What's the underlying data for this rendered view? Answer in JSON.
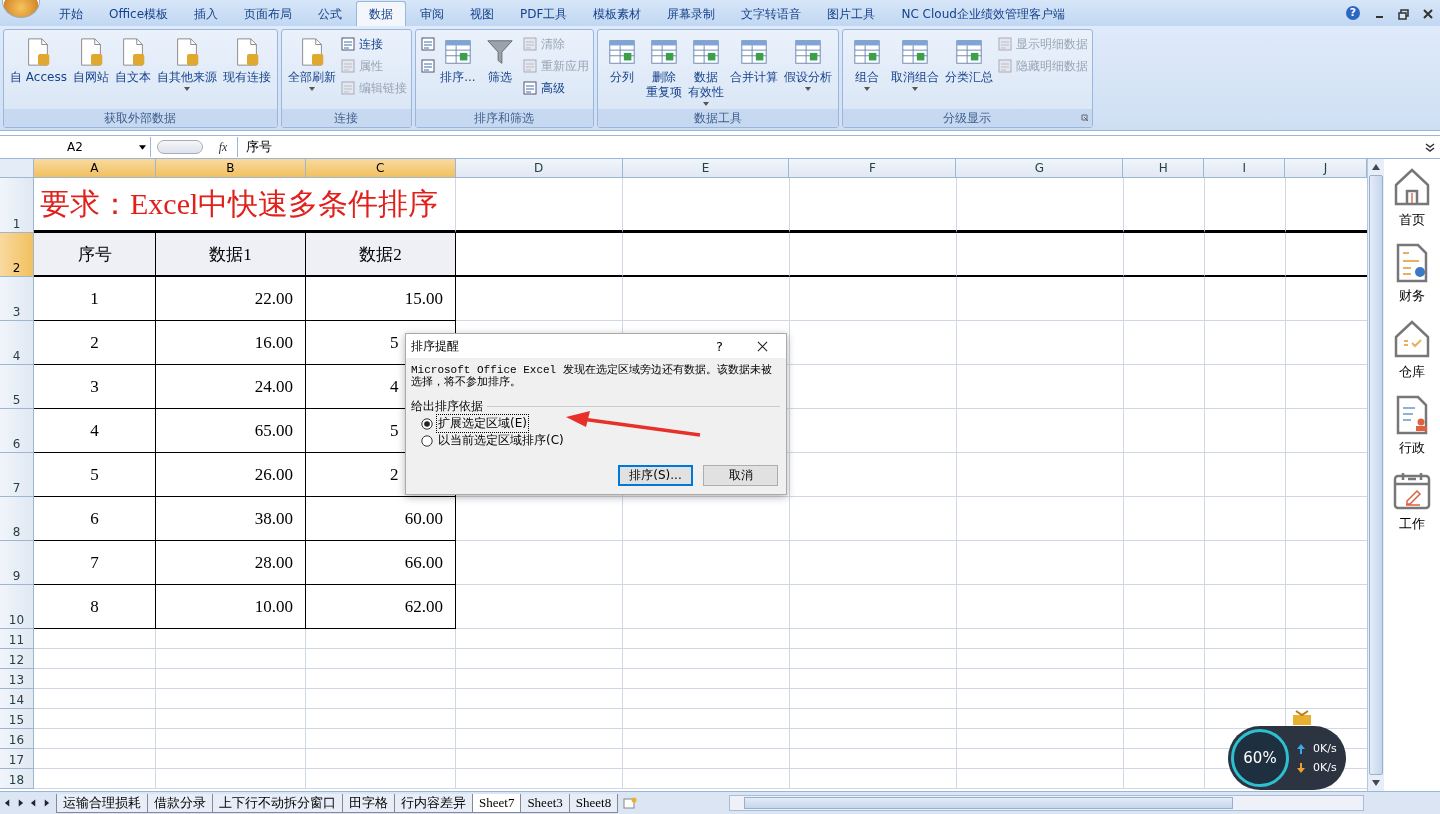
{
  "menu_tabs": [
    {
      "label": "开始",
      "selected": false
    },
    {
      "label": "Office模板",
      "selected": false
    },
    {
      "label": "插入",
      "selected": false
    },
    {
      "label": "页面布局",
      "selected": false
    },
    {
      "label": "公式",
      "selected": false
    },
    {
      "label": "数据",
      "selected": true
    },
    {
      "label": "审阅",
      "selected": false
    },
    {
      "label": "视图",
      "selected": false
    },
    {
      "label": "PDF工具",
      "selected": false
    },
    {
      "label": "模板素材",
      "selected": false
    },
    {
      "label": "屏幕录制",
      "selected": false
    },
    {
      "label": "文字转语音",
      "selected": false
    },
    {
      "label": "图片工具",
      "selected": false
    },
    {
      "label": "NC Cloud企业绩效管理客户端",
      "selected": false
    }
  ],
  "help_glyph": "?",
  "ribbon_groups": [
    {
      "label": "获取外部数据",
      "launcher": false,
      "items": [
        {
          "kind": "large",
          "lines": [
            "自 Access"
          ],
          "dropdown": false
        },
        {
          "kind": "large",
          "lines": [
            "自网站"
          ],
          "dropdown": false
        },
        {
          "kind": "large",
          "lines": [
            "自文本"
          ],
          "dropdown": false
        },
        {
          "kind": "large",
          "lines": [
            "自其他来源"
          ],
          "dropdown": true
        },
        {
          "kind": "large",
          "lines": [
            "现有连接"
          ],
          "dropdown": false
        }
      ]
    },
    {
      "label": "连接",
      "launcher": false,
      "items": [
        {
          "kind": "large",
          "lines": [
            "全部刷新"
          ],
          "dropdown": true
        },
        {
          "kind": "stack",
          "items": [
            {
              "label": "连接",
              "disabled": false
            },
            {
              "label": "属性",
              "disabled": true
            },
            {
              "label": "编辑链接",
              "disabled": true
            }
          ]
        }
      ]
    },
    {
      "label": "排序和筛选",
      "launcher": false,
      "items": [
        {
          "kind": "stack",
          "items": [
            {
              "disabled": false
            },
            {
              "disabled": false
            }
          ]
        },
        {
          "kind": "large",
          "lines": [
            "排序..."
          ],
          "dropdown": false
        },
        {
          "kind": "large",
          "lines": [
            "筛选"
          ],
          "dropdown": false
        },
        {
          "kind": "stack",
          "items": [
            {
              "label": "清除",
              "disabled": true
            },
            {
              "label": "重新应用",
              "disabled": true
            },
            {
              "label": "高级",
              "disabled": false
            }
          ]
        }
      ]
    },
    {
      "label": "数据工具",
      "launcher": false,
      "items": [
        {
          "kind": "large",
          "lines": [
            "分列"
          ],
          "dropdown": false
        },
        {
          "kind": "large",
          "lines": [
            "删除",
            "重复项"
          ],
          "dropdown": false
        },
        {
          "kind": "large",
          "lines": [
            "数据",
            "有效性"
          ],
          "dropdown": true
        },
        {
          "kind": "large",
          "lines": [
            "合并计算"
          ],
          "dropdown": false
        },
        {
          "kind": "large",
          "lines": [
            "假设分析"
          ],
          "dropdown": true
        }
      ]
    },
    {
      "label": "分级显示",
      "launcher": true,
      "items": [
        {
          "kind": "large",
          "lines": [
            "组合"
          ],
          "dropdown": true
        },
        {
          "kind": "large",
          "lines": [
            "取消组合"
          ],
          "dropdown": true
        },
        {
          "kind": "large",
          "lines": [
            "分类汇总"
          ],
          "dropdown": false
        },
        {
          "kind": "stack",
          "items": [
            {
              "label": "显示明细数据",
              "disabled": true
            },
            {
              "label": "隐藏明细数据",
              "disabled": true
            }
          ]
        }
      ]
    }
  ],
  "formula_bar": {
    "name_box": "A2",
    "function_label": "fx",
    "formula": "序号"
  },
  "columns": [
    {
      "label": "A",
      "selected": true
    },
    {
      "label": "B",
      "selected": true
    },
    {
      "label": "C",
      "selected": true
    },
    {
      "label": "D",
      "selected": false
    },
    {
      "label": "E",
      "selected": false
    },
    {
      "label": "F",
      "selected": false
    },
    {
      "label": "G",
      "selected": false
    },
    {
      "label": "H",
      "selected": false
    },
    {
      "label": "I",
      "selected": false
    },
    {
      "label": "J",
      "selected": false
    }
  ],
  "rows": [
    {
      "label": "1",
      "selected": false
    },
    {
      "label": "2",
      "selected": true
    },
    {
      "label": "3",
      "selected": false
    },
    {
      "label": "4",
      "selected": false
    },
    {
      "label": "5",
      "selected": false
    },
    {
      "label": "6",
      "selected": false
    },
    {
      "label": "7",
      "selected": false
    },
    {
      "label": "8",
      "selected": false
    },
    {
      "label": "9",
      "selected": false
    },
    {
      "label": "10",
      "selected": false
    },
    {
      "label": "11",
      "selected": false
    },
    {
      "label": "12",
      "selected": false
    },
    {
      "label": "13",
      "selected": false
    },
    {
      "label": "14",
      "selected": false
    },
    {
      "label": "15",
      "selected": false
    },
    {
      "label": "16",
      "selected": false
    },
    {
      "label": "17",
      "selected": false
    },
    {
      "label": "18",
      "selected": false
    }
  ],
  "sheet_title": "要求：Excel中快速多条件排序",
  "table_header": [
    "序号",
    "数据1",
    "数据2"
  ],
  "table_rows": [
    {
      "cells": [
        "1",
        "22.00",
        "15.00"
      ],
      "last_cut": false
    },
    {
      "cells": [
        "2",
        "16.00",
        "5"
      ],
      "last_cut": true
    },
    {
      "cells": [
        "3",
        "24.00",
        "4"
      ],
      "last_cut": true
    },
    {
      "cells": [
        "4",
        "65.00",
        "5"
      ],
      "last_cut": true
    },
    {
      "cells": [
        "5",
        "26.00",
        "2"
      ],
      "last_cut": true
    },
    {
      "cells": [
        "6",
        "38.00",
        "60.00"
      ],
      "last_cut": false
    },
    {
      "cells": [
        "7",
        "28.00",
        "66.00"
      ],
      "last_cut": false
    },
    {
      "cells": [
        "8",
        "10.00",
        "62.00"
      ],
      "last_cut": false
    }
  ],
  "dialog": {
    "title": "排序提醒",
    "help": "?",
    "message": "Microsoft Office Excel 发现在选定区域旁边还有数据。该数据未被选择，将不参加排序。",
    "group_label": "给出排序依据",
    "options": [
      {
        "label": "扩展选定区域(E)",
        "selected": true
      },
      {
        "label": "以当前选定区域排序(C)",
        "selected": false
      }
    ],
    "buttons": [
      "排序(S)...",
      "取消"
    ]
  },
  "sheet_tabs": [
    {
      "label": "运输合理损耗",
      "selected": false
    },
    {
      "label": "借款分录",
      "selected": false
    },
    {
      "label": "上下行不动拆分窗口",
      "selected": false
    },
    {
      "label": "田字格",
      "selected": false
    },
    {
      "label": "行内容差异",
      "selected": false
    },
    {
      "label": "Sheet7",
      "selected": true
    },
    {
      "label": "Sheet3",
      "selected": false
    },
    {
      "label": "Sheet8",
      "selected": false
    }
  ],
  "sidebar": [
    {
      "label": "首页"
    },
    {
      "label": "财务"
    },
    {
      "label": "仓库"
    },
    {
      "label": "行政"
    },
    {
      "label": "工作"
    }
  ],
  "speed_widget": {
    "percent": "60%",
    "upload": "0K/s",
    "download": "0K/s"
  }
}
